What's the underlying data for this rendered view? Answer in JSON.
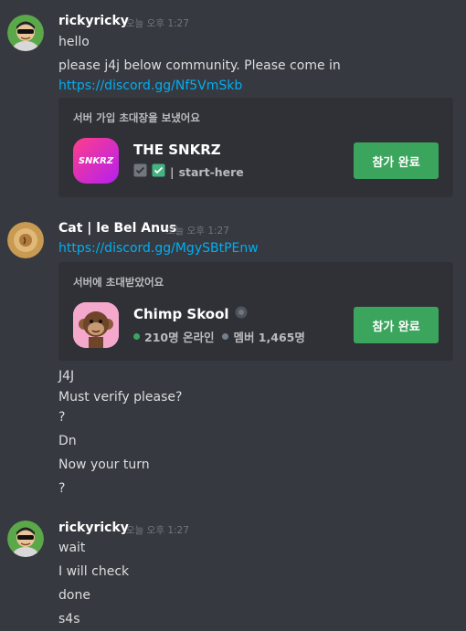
{
  "messages": {
    "group1": {
      "username": "rickyricky",
      "timestamp": "오늘 오후 1:27",
      "lines": [
        "hello",
        "please j4j below community. Please come in"
      ],
      "link": "https://discord.gg/Nf5VmSkb",
      "invite": {
        "header": "서버 가입 초대장을 보냈어요",
        "server_icon_text": "SNKRZ",
        "server_name": "THE SNKRZ",
        "channel_sep": "|",
        "channel": "start-here",
        "button_label": "참가 완료",
        "icon_colors": [
          "#ff3e8a",
          "#b41ff0"
        ]
      }
    },
    "group2": {
      "username": "Cat | le Bel Anus",
      "timestamp": "오늘 오후 1:27",
      "link": "https://discord.gg/MgySBtPEnw",
      "invite": {
        "header": "서버에 초대받았어요",
        "server_name": "Chimp Skool",
        "online": "210명 온라인",
        "members": "멤버 1,465명",
        "button_label": "참가 완료"
      },
      "lines": [
        "J4J",
        "Must verify please?",
        "?",
        "Dn",
        "Now your turn",
        "?"
      ]
    },
    "group3": {
      "username": "rickyricky",
      "timestamp": "오늘 오후 1:27",
      "lines": [
        "wait",
        "I will check",
        "done",
        "s4s"
      ]
    }
  },
  "colors": {
    "background": "#36393f",
    "embed": "#2f3136",
    "link": "#00aff4",
    "button": "#3ba55d",
    "online": "#3ba55d",
    "member": "#747f8d"
  }
}
